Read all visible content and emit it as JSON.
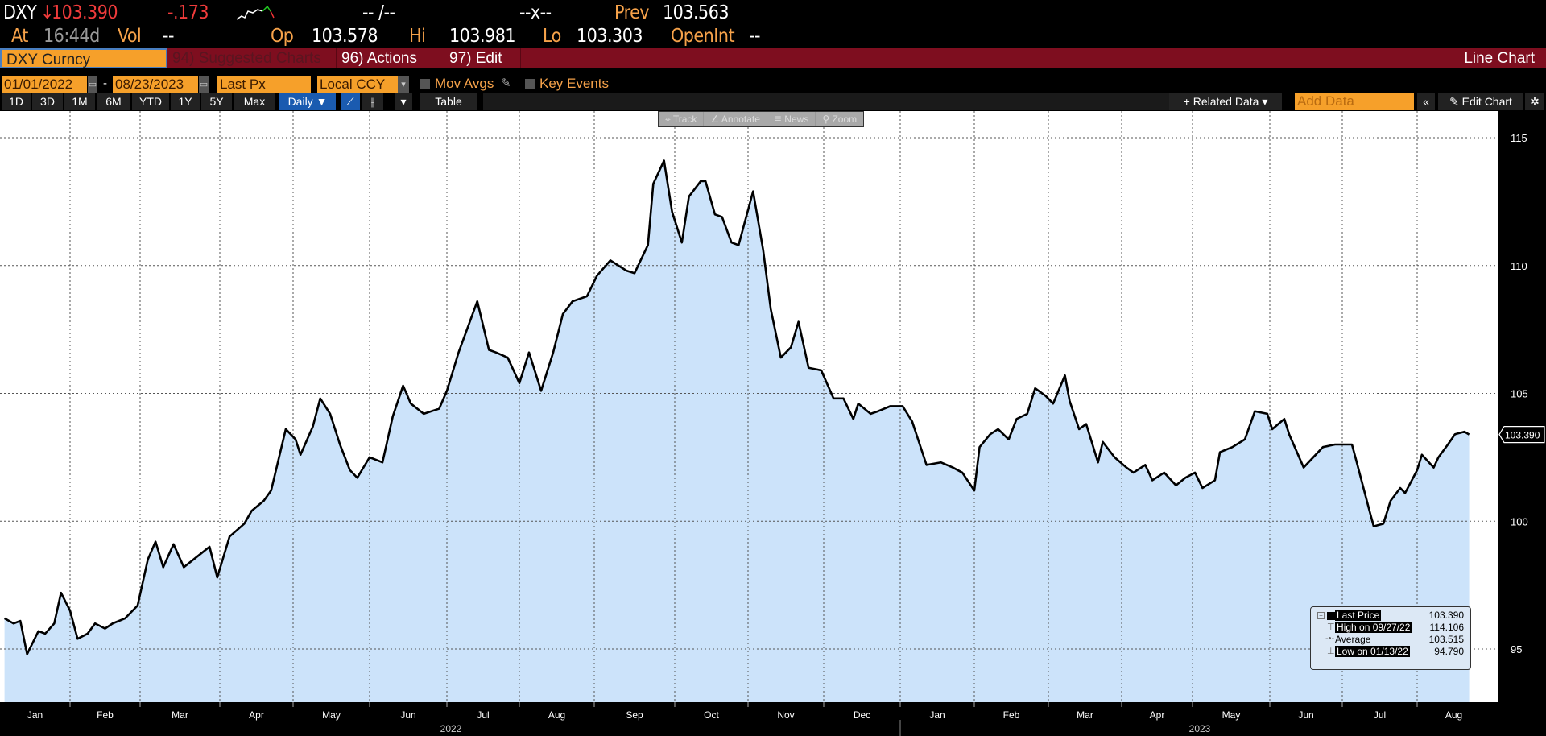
{
  "quote": {
    "ticker": "DXY",
    "arrow": "↓",
    "last": "103.390",
    "change": "-.173",
    "bidask": "-- /--",
    "size": "--x--",
    "prev_label": "Prev",
    "prev": "103.563",
    "at_label": "At",
    "time": "16:44d",
    "vol_label": "Vol",
    "vol": "--",
    "op_label": "Op",
    "op": "103.578",
    "hi_label": "Hi",
    "hi": "103.981",
    "lo_label": "Lo",
    "lo": "103.303",
    "oi_label": "OpenInt",
    "oi": "--"
  },
  "command": {
    "security": "DXY Curncy",
    "suggested": "94) Suggested Charts",
    "actions": "96) Actions",
    "edit": "97) Edit",
    "title": "Line Chart"
  },
  "settings": {
    "start": "01/01/2022",
    "sep": "-",
    "end": "08/23/2023",
    "field": "Last Px",
    "currency": "Local CCY",
    "mov_avgs": "Mov Avgs",
    "key_events": "Key Events"
  },
  "periods": [
    "1D",
    "3D",
    "1M",
    "6M",
    "YTD",
    "1Y",
    "5Y",
    "Max"
  ],
  "frequency": "Daily ▼",
  "table_label": "Table",
  "related_data": "+ Related Data ▾",
  "add_data_placeholder": "Add Data",
  "edit_chart": "✎ Edit Chart",
  "overlay_tools": [
    "⌖ Track",
    "∠ Annotate",
    "≣ News",
    "⚲ Zoom"
  ],
  "legend": {
    "rows": [
      {
        "label": "Last Price",
        "value": "103.390"
      },
      {
        "label": "High on 09/27/22",
        "value": "114.106"
      },
      {
        "label": "Average",
        "value": "103.515"
      },
      {
        "label": "Low on 01/13/22",
        "value": "94.790"
      }
    ]
  },
  "colors": {
    "fill": "#cce3fa",
    "line": "#000000",
    "bar": "#7e0e1f",
    "accent": "#f6a02a"
  },
  "chart_data": {
    "type": "area",
    "title": "DXY Curncy",
    "ylim": [
      93,
      116
    ],
    "yticks": [
      95,
      100,
      105,
      110,
      115
    ],
    "last_label": "103.390",
    "months": [
      "Jan",
      "Feb",
      "Mar",
      "Apr",
      "May",
      "Jun",
      "Jul",
      "Aug",
      "Sep",
      "Oct",
      "Nov",
      "Dec",
      "Jan",
      "Feb",
      "Mar",
      "Apr",
      "May",
      "Jun",
      "Jul",
      "Aug"
    ],
    "years": [
      "2022",
      "2023"
    ],
    "points": [
      [
        "2022-01-03",
        96.2
      ],
      [
        "2022-01-07",
        96.0
      ],
      [
        "2022-01-10",
        96.1
      ],
      [
        "2022-01-13",
        94.8
      ],
      [
        "2022-01-18",
        95.7
      ],
      [
        "2022-01-21",
        95.6
      ],
      [
        "2022-01-25",
        96.0
      ],
      [
        "2022-01-28",
        97.2
      ],
      [
        "2022-02-01",
        96.5
      ],
      [
        "2022-02-04",
        95.4
      ],
      [
        "2022-02-08",
        95.6
      ],
      [
        "2022-02-11",
        96.0
      ],
      [
        "2022-02-15",
        95.8
      ],
      [
        "2022-02-18",
        96.0
      ],
      [
        "2022-02-23",
        96.2
      ],
      [
        "2022-02-28",
        96.7
      ],
      [
        "2022-03-04",
        98.5
      ],
      [
        "2022-03-07",
        99.2
      ],
      [
        "2022-03-10",
        98.2
      ],
      [
        "2022-03-14",
        99.1
      ],
      [
        "2022-03-18",
        98.2
      ],
      [
        "2022-03-23",
        98.6
      ],
      [
        "2022-03-28",
        99.0
      ],
      [
        "2022-03-31",
        97.8
      ],
      [
        "2022-04-05",
        99.4
      ],
      [
        "2022-04-11",
        99.9
      ],
      [
        "2022-04-14",
        100.4
      ],
      [
        "2022-04-19",
        100.8
      ],
      [
        "2022-04-22",
        101.2
      ],
      [
        "2022-04-28",
        103.6
      ],
      [
        "2022-05-02",
        103.2
      ],
      [
        "2022-05-04",
        102.6
      ],
      [
        "2022-05-09",
        103.7
      ],
      [
        "2022-05-12",
        104.8
      ],
      [
        "2022-05-16",
        104.2
      ],
      [
        "2022-05-20",
        103.0
      ],
      [
        "2022-05-24",
        102.0
      ],
      [
        "2022-05-27",
        101.7
      ],
      [
        "2022-06-01",
        102.5
      ],
      [
        "2022-06-06",
        102.3
      ],
      [
        "2022-06-10",
        104.1
      ],
      [
        "2022-06-14",
        105.3
      ],
      [
        "2022-06-17",
        104.6
      ],
      [
        "2022-06-22",
        104.2
      ],
      [
        "2022-06-28",
        104.4
      ],
      [
        "2022-07-01",
        105.1
      ],
      [
        "2022-07-06",
        106.6
      ],
      [
        "2022-07-12",
        108.1
      ],
      [
        "2022-07-14",
        108.6
      ],
      [
        "2022-07-19",
        106.7
      ],
      [
        "2022-07-22",
        106.6
      ],
      [
        "2022-07-27",
        106.4
      ],
      [
        "2022-08-01",
        105.4
      ],
      [
        "2022-08-05",
        106.6
      ],
      [
        "2022-08-10",
        105.1
      ],
      [
        "2022-08-15",
        106.6
      ],
      [
        "2022-08-19",
        108.1
      ],
      [
        "2022-08-23",
        108.6
      ],
      [
        "2022-08-29",
        108.8
      ],
      [
        "2022-09-02",
        109.6
      ],
      [
        "2022-09-07",
        110.2
      ],
      [
        "2022-09-13",
        109.8
      ],
      [
        "2022-09-16",
        109.7
      ],
      [
        "2022-09-21",
        110.8
      ],
      [
        "2022-09-23",
        113.2
      ],
      [
        "2022-09-27",
        114.1
      ],
      [
        "2022-09-30",
        112.1
      ],
      [
        "2022-10-04",
        110.9
      ],
      [
        "2022-10-07",
        112.7
      ],
      [
        "2022-10-12",
        113.3
      ],
      [
        "2022-10-14",
        113.3
      ],
      [
        "2022-10-18",
        112.0
      ],
      [
        "2022-10-21",
        111.9
      ],
      [
        "2022-10-25",
        110.9
      ],
      [
        "2022-10-28",
        110.8
      ],
      [
        "2022-11-03",
        112.9
      ],
      [
        "2022-11-07",
        110.6
      ],
      [
        "2022-11-10",
        108.3
      ],
      [
        "2022-11-14",
        106.4
      ],
      [
        "2022-11-18",
        106.8
      ],
      [
        "2022-11-21",
        107.8
      ],
      [
        "2022-11-25",
        106.0
      ],
      [
        "2022-11-30",
        105.9
      ],
      [
        "2022-12-05",
        104.8
      ],
      [
        "2022-12-09",
        104.8
      ],
      [
        "2022-12-13",
        104.0
      ],
      [
        "2022-12-15",
        104.6
      ],
      [
        "2022-12-20",
        104.2
      ],
      [
        "2022-12-23",
        104.3
      ],
      [
        "2022-12-28",
        104.5
      ],
      [
        "2023-01-02",
        104.5
      ],
      [
        "2023-01-06",
        103.9
      ],
      [
        "2023-01-12",
        102.2
      ],
      [
        "2023-01-18",
        102.3
      ],
      [
        "2023-01-23",
        102.1
      ],
      [
        "2023-01-27",
        101.9
      ],
      [
        "2023-02-01",
        101.2
      ],
      [
        "2023-02-03",
        102.9
      ],
      [
        "2023-02-07",
        103.4
      ],
      [
        "2023-02-10",
        103.6
      ],
      [
        "2023-02-14",
        103.2
      ],
      [
        "2023-02-17",
        104.0
      ],
      [
        "2023-02-21",
        104.2
      ],
      [
        "2023-02-24",
        105.2
      ],
      [
        "2023-02-28",
        104.9
      ],
      [
        "2023-03-03",
        104.6
      ],
      [
        "2023-03-08",
        105.7
      ],
      [
        "2023-03-10",
        104.7
      ],
      [
        "2023-03-14",
        103.6
      ],
      [
        "2023-03-17",
        103.8
      ],
      [
        "2023-03-22",
        102.3
      ],
      [
        "2023-03-24",
        103.1
      ],
      [
        "2023-03-29",
        102.5
      ],
      [
        "2023-04-03",
        102.1
      ],
      [
        "2023-04-06",
        101.9
      ],
      [
        "2023-04-11",
        102.2
      ],
      [
        "2023-04-14",
        101.6
      ],
      [
        "2023-04-19",
        101.9
      ],
      [
        "2023-04-24",
        101.4
      ],
      [
        "2023-04-28",
        101.7
      ],
      [
        "2023-05-02",
        101.9
      ],
      [
        "2023-05-05",
        101.3
      ],
      [
        "2023-05-10",
        101.6
      ],
      [
        "2023-05-12",
        102.7
      ],
      [
        "2023-05-17",
        102.9
      ],
      [
        "2023-05-22",
        103.2
      ],
      [
        "2023-05-26",
        104.3
      ],
      [
        "2023-05-31",
        104.2
      ],
      [
        "2023-06-02",
        103.6
      ],
      [
        "2023-06-07",
        104.0
      ],
      [
        "2023-06-09",
        103.4
      ],
      [
        "2023-06-15",
        102.1
      ],
      [
        "2023-06-20",
        102.6
      ],
      [
        "2023-06-23",
        102.9
      ],
      [
        "2023-06-28",
        103.0
      ],
      [
        "2023-07-05",
        103.0
      ],
      [
        "2023-07-07",
        102.3
      ],
      [
        "2023-07-12",
        100.5
      ],
      [
        "2023-07-14",
        99.8
      ],
      [
        "2023-07-18",
        99.9
      ],
      [
        "2023-07-21",
        100.8
      ],
      [
        "2023-07-25",
        101.3
      ],
      [
        "2023-07-27",
        101.1
      ],
      [
        "2023-08-01",
        102.0
      ],
      [
        "2023-08-03",
        102.6
      ],
      [
        "2023-08-08",
        102.1
      ],
      [
        "2023-08-10",
        102.5
      ],
      [
        "2023-08-14",
        103.0
      ],
      [
        "2023-08-17",
        103.4
      ],
      [
        "2023-08-21",
        103.5
      ],
      [
        "2023-08-23",
        103.39
      ]
    ]
  }
}
